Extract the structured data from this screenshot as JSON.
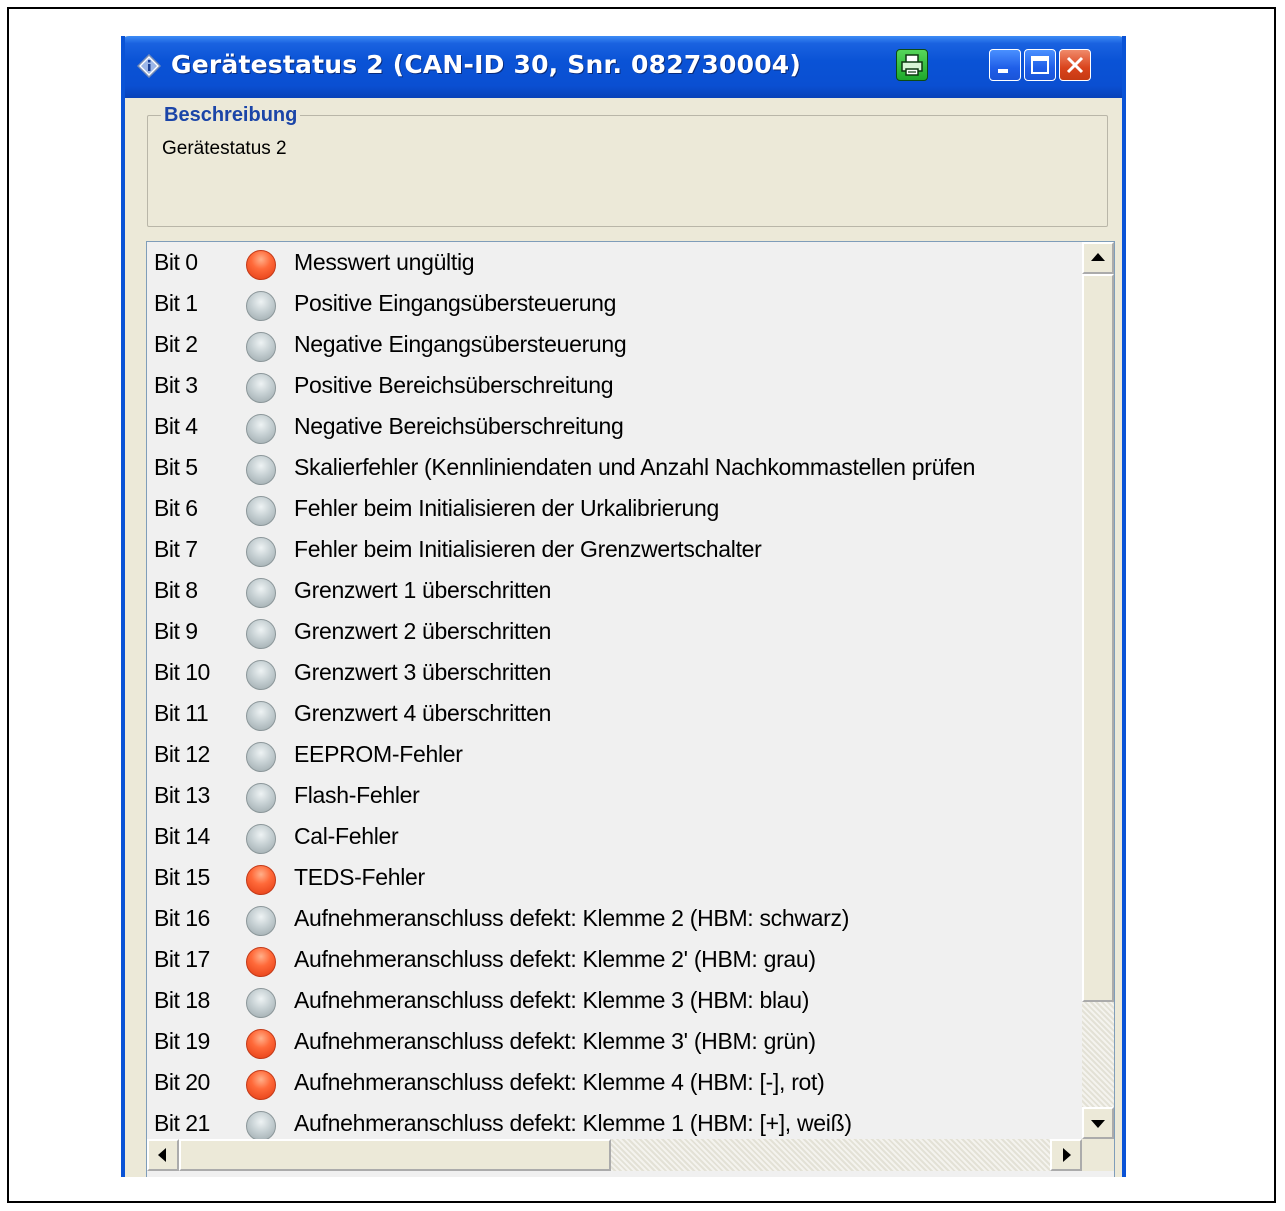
{
  "window": {
    "title": "Gerätestatus 2 (CAN-ID 30, Snr. 082730004)"
  },
  "description_group": {
    "legend": "Beschreibung",
    "text": "Gerätestatus 2"
  },
  "colors": {
    "led_on": "#ff5a2a",
    "led_off": "#b8c4c8",
    "titlebar": "#0a53d6",
    "legend_text": "#1b45a8"
  },
  "status_bits": [
    {
      "bit": "Bit 0",
      "label": "Messwert ungültig",
      "active": true
    },
    {
      "bit": "Bit 1",
      "label": "Positive Eingangsübersteuerung",
      "active": false
    },
    {
      "bit": "Bit 2",
      "label": "Negative Eingangsübersteuerung",
      "active": false
    },
    {
      "bit": "Bit 3",
      "label": "Positive Bereichsüberschreitung",
      "active": false
    },
    {
      "bit": "Bit 4",
      "label": "Negative Bereichsüberschreitung",
      "active": false
    },
    {
      "bit": "Bit 5",
      "label": "Skalierfehler (Kennliniendaten und Anzahl Nachkommastellen prüfen",
      "active": false
    },
    {
      "bit": "Bit 6",
      "label": "Fehler beim Initialisieren der Urkalibrierung",
      "active": false
    },
    {
      "bit": "Bit 7",
      "label": "Fehler beim Initialisieren der Grenzwertschalter",
      "active": false
    },
    {
      "bit": "Bit 8",
      "label": "Grenzwert 1 überschritten",
      "active": false
    },
    {
      "bit": "Bit 9",
      "label": "Grenzwert 2 überschritten",
      "active": false
    },
    {
      "bit": "Bit 10",
      "label": "Grenzwert 3 überschritten",
      "active": false
    },
    {
      "bit": "Bit 11",
      "label": "Grenzwert 4 überschritten",
      "active": false
    },
    {
      "bit": "Bit 12",
      "label": "EEPROM-Fehler",
      "active": false
    },
    {
      "bit": "Bit 13",
      "label": "Flash-Fehler",
      "active": false
    },
    {
      "bit": "Bit 14",
      "label": "Cal-Fehler",
      "active": false
    },
    {
      "bit": "Bit 15",
      "label": "TEDS-Fehler",
      "active": true
    },
    {
      "bit": "Bit 16",
      "label": "Aufnehmeranschluss defekt: Klemme 2 (HBM: schwarz)",
      "active": false
    },
    {
      "bit": "Bit 17",
      "label": "Aufnehmeranschluss defekt: Klemme 2' (HBM: grau)",
      "active": true
    },
    {
      "bit": "Bit 18",
      "label": "Aufnehmeranschluss defekt: Klemme 3 (HBM: blau)",
      "active": false
    },
    {
      "bit": "Bit 19",
      "label": "Aufnehmeranschluss defekt: Klemme 3' (HBM: grün)",
      "active": true
    },
    {
      "bit": "Bit 20",
      "label": "Aufnehmeranschluss defekt: Klemme 4 (HBM: [-], rot)",
      "active": true
    },
    {
      "bit": "Bit 21",
      "label": "Aufnehmeranschluss defekt: Klemme 1 (HBM: [+], weiß)",
      "active": false
    }
  ]
}
